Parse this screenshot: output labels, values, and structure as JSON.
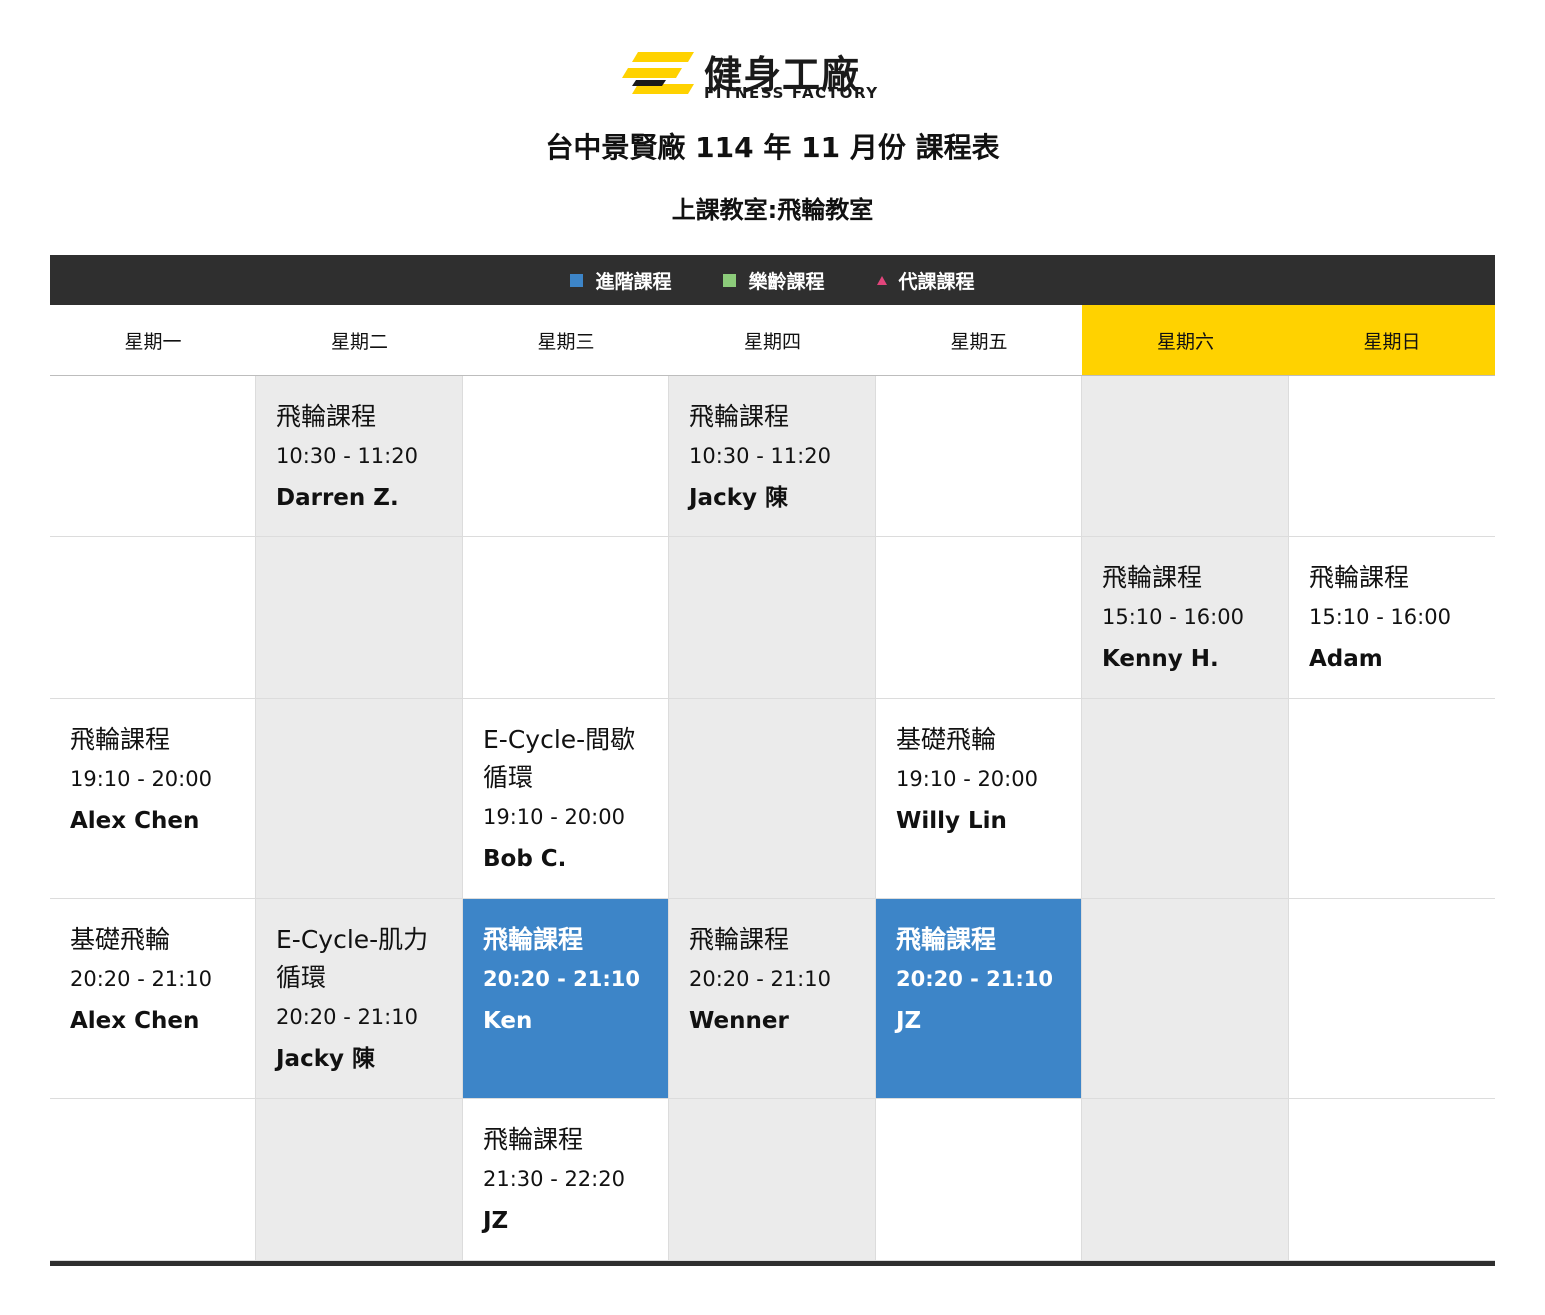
{
  "logo": {
    "zh": "健身工廠",
    "en": "FITNESS FACTORY",
    "colors": {
      "yellow": "#ffd200",
      "dark": "#1a1a1a"
    }
  },
  "title": "台中景賢廠 114 年 11 月份 課程表",
  "subtitle": "上課教室:飛輪教室",
  "legend": [
    {
      "label": "進階課程",
      "marker": "blue-square",
      "color": "#3d85c8"
    },
    {
      "label": "樂齡課程",
      "marker": "green-square",
      "color": "#8ccb7a"
    },
    {
      "label": "代課課程",
      "marker": "pink-triangle",
      "color": "#e2457b"
    }
  ],
  "days": [
    "星期一",
    "星期二",
    "星期三",
    "星期四",
    "星期五",
    "星期六",
    "星期日"
  ],
  "rows": [
    [
      null,
      {
        "name": "飛輪課程",
        "time": "10:30 - 11:20",
        "coach": "Darren Z."
      },
      null,
      {
        "name": "飛輪課程",
        "time": "10:30 - 11:20",
        "coach": "Jacky 陳"
      },
      null,
      null,
      null
    ],
    [
      null,
      null,
      null,
      null,
      null,
      {
        "name": "飛輪課程",
        "time": "15:10 - 16:00",
        "coach": "Kenny H."
      },
      {
        "name": "飛輪課程",
        "time": "15:10 - 16:00",
        "coach": "Adam"
      }
    ],
    [
      {
        "name": "飛輪課程",
        "time": "19:10 - 20:00",
        "coach": "Alex Chen"
      },
      null,
      {
        "name": "E-Cycle-間歇循環",
        "time": "19:10 - 20:00",
        "coach": "Bob C."
      },
      null,
      {
        "name": "基礎飛輪",
        "time": "19:10 - 20:00",
        "coach": "Willy Lin"
      },
      null,
      null
    ],
    [
      {
        "name": "基礎飛輪",
        "time": "20:20 - 21:10",
        "coach": "Alex Chen"
      },
      {
        "name": "E-Cycle-肌力循環",
        "time": "20:20 - 21:10",
        "coach": "Jacky 陳"
      },
      {
        "name": "飛輪課程",
        "time": "20:20 - 21:10",
        "coach": "Ken",
        "type": "advanced"
      },
      {
        "name": "飛輪課程",
        "time": "20:20 - 21:10",
        "coach": "Wenner"
      },
      {
        "name": "飛輪課程",
        "time": "20:20 - 21:10",
        "coach": "JZ",
        "type": "advanced"
      },
      null,
      null
    ],
    [
      null,
      null,
      {
        "name": "飛輪課程",
        "time": "21:30 - 22:20",
        "coach": "JZ"
      },
      null,
      null,
      null,
      null
    ]
  ],
  "colors": {
    "legend_bar": "#2f2f2f",
    "weekend_header": "#ffd200",
    "advanced_cell": "#3d85c8",
    "alt_column": "#ebebeb"
  }
}
